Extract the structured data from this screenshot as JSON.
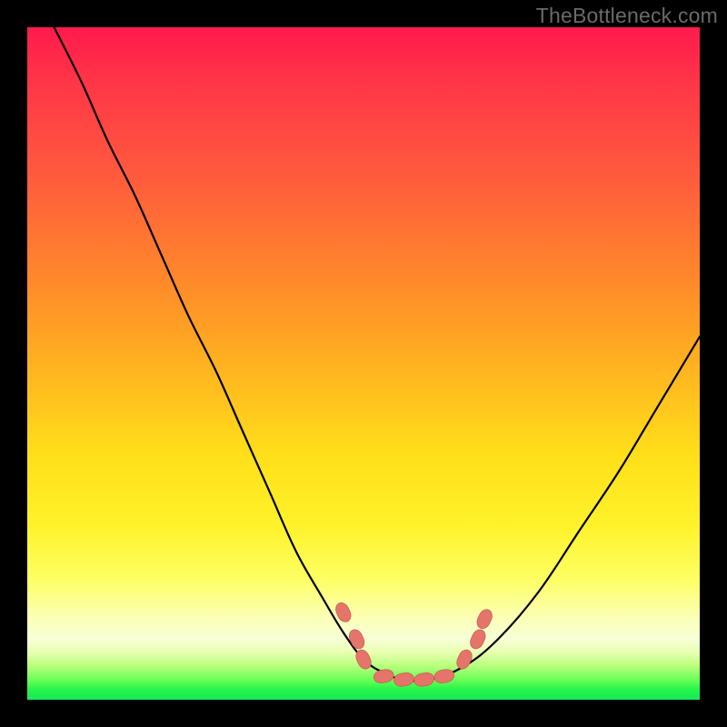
{
  "watermark": "TheBottleneck.com",
  "colors": {
    "frame": "#000000",
    "gradient_top": "#ff1a4d",
    "gradient_mid": "#ffe01a",
    "gradient_bottom": "#18e85a",
    "curve": "#000000",
    "markers": "#e5756a"
  },
  "chart_data": {
    "type": "line",
    "title": "",
    "xlabel": "",
    "ylabel": "",
    "xlim": [
      0,
      100
    ],
    "ylim": [
      0,
      100
    ],
    "grid": false,
    "legend": false,
    "series": [
      {
        "name": "bottleneck-curve",
        "x": [
          4,
          8,
          12,
          16,
          20,
          24,
          28,
          32,
          36,
          40,
          44,
          47,
          50,
          53,
          56,
          60,
          65,
          70,
          76,
          82,
          88,
          94,
          100
        ],
        "y": [
          100,
          92,
          83,
          75,
          66,
          57,
          49,
          40,
          31,
          22,
          15,
          10,
          6,
          4,
          3,
          3,
          5,
          9,
          16,
          25,
          34,
          44,
          54
        ]
      }
    ],
    "markers": [
      {
        "name": "left-upper",
        "x": 47,
        "y": 13
      },
      {
        "name": "left-mid",
        "x": 49,
        "y": 9
      },
      {
        "name": "left-low",
        "x": 50,
        "y": 6
      },
      {
        "name": "valley-a",
        "x": 53,
        "y": 3.5
      },
      {
        "name": "valley-b",
        "x": 56,
        "y": 3
      },
      {
        "name": "valley-c",
        "x": 59,
        "y": 3
      },
      {
        "name": "valley-d",
        "x": 62,
        "y": 3.5
      },
      {
        "name": "right-low",
        "x": 65,
        "y": 6
      },
      {
        "name": "right-mid",
        "x": 67,
        "y": 9
      },
      {
        "name": "right-upper",
        "x": 68,
        "y": 12
      }
    ]
  }
}
